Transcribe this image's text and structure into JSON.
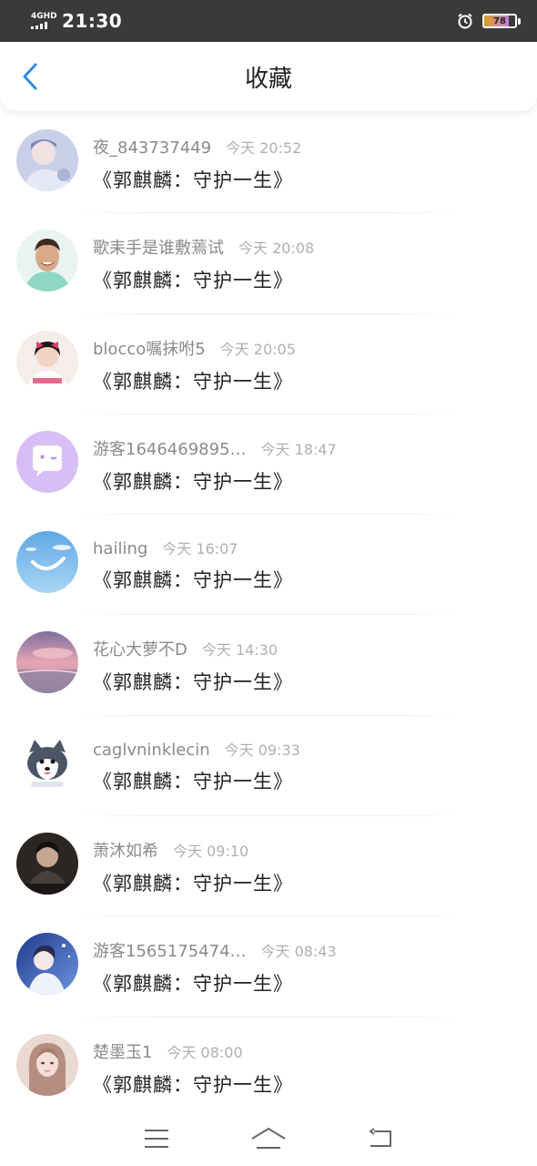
{
  "status_bar": {
    "network": "4GHD",
    "time": "21:30",
    "battery_level": "78"
  },
  "header": {
    "title": "收藏",
    "back_icon": "chevron-left-icon",
    "accent_color": "#2a8de0"
  },
  "favorites": [
    {
      "username": "夜_843737449",
      "time": "今天 20:52",
      "title": "《郭麒麟：守护一生》",
      "avatar": "avatar-portrait-blue"
    },
    {
      "username": "歌耒手是谁敷蔫试",
      "time": "今天 20:08",
      "title": "《郭麒麟：守护一生》",
      "avatar": "avatar-smiling-man"
    },
    {
      "username": "blocco嘱抹咐5",
      "time": "今天 20:05",
      "title": "《郭麒麟：守护一生》",
      "avatar": "avatar-girl-bow"
    },
    {
      "username": "游客1646469895…",
      "time": "今天 18:47",
      "title": "《郭麒麟：守护一生》",
      "avatar": "avatar-purple-chat"
    },
    {
      "username": "hailing",
      "time": "今天 16:07",
      "title": "《郭麒麟：守护一生》",
      "avatar": "avatar-blue-sky"
    },
    {
      "username": "花心大萝不D",
      "time": "今天 14:30",
      "title": "《郭麒麟：守护一生》",
      "avatar": "avatar-sunset-sea"
    },
    {
      "username": "caglvninklecin",
      "time": "今天 09:33",
      "title": "《郭麒麟：守护一生》",
      "avatar": "avatar-husky"
    },
    {
      "username": "萧沐如希",
      "time": "今天 09:10",
      "title": "《郭麒麟：守护一生》",
      "avatar": "avatar-dark-portrait"
    },
    {
      "username": "游客1565175474…",
      "time": "今天 08:43",
      "title": "《郭麒麟：守护一生》",
      "avatar": "avatar-anime-blue"
    },
    {
      "username": "楚墨玉1",
      "time": "今天 08:00",
      "title": "《郭麒麟：守护一生》",
      "avatar": "avatar-girl-portrait"
    }
  ],
  "bottom_nav": {
    "menu_icon": "menu-icon",
    "home_icon": "home-icon",
    "back_icon": "back-arrow-icon"
  }
}
